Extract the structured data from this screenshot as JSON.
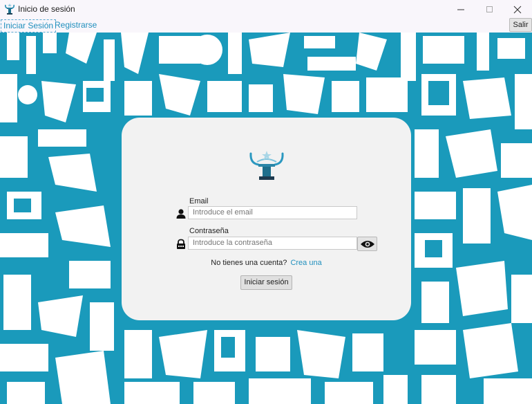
{
  "window": {
    "title": "Inicio de sesión"
  },
  "menu": {
    "login_label": "Iniciar Sesión",
    "register_label": "Registrarse",
    "exit_label": "Salir"
  },
  "form": {
    "email_label": "Email",
    "email_placeholder": "Introduce el email",
    "password_label": "Contraseña",
    "password_placeholder": "Introduce la contraseña",
    "no_account_text": "No tienes una cuenta?",
    "create_link": "Crea una",
    "submit_label": "Iniciar sesión"
  },
  "colors": {
    "accent": "#1f8fbd",
    "pattern": "#1a9abb",
    "card": "#f2f2f2"
  }
}
